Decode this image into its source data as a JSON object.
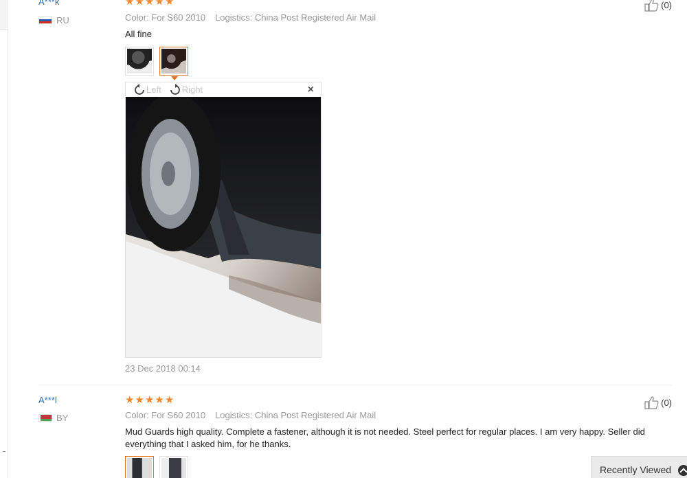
{
  "reviews": [
    {
      "user": "A***k",
      "country": "RU",
      "stars": 5,
      "color_label": "Color: For S60 2010",
      "logistics_label": "Logistics: China Post Registered Air Mail",
      "feedback": "All fine",
      "date": "23 Dec 2018 00:14",
      "helpful_count": "(0)",
      "viewer": {
        "rotate_left": "Left",
        "rotate_right": "Right",
        "close": "×"
      }
    },
    {
      "user": "A***l",
      "country": "BY",
      "stars": 5,
      "color_label": "Color: For S60 2010",
      "logistics_label": "Logistics: China Post Registered Air Mail",
      "feedback": "Mud Guards high quality. Complete a fastener, although it is not needed. Steel perfect for regular places. I am very happy. Seller did everything that I asked him, for he thanks.",
      "helpful_count": "(0)"
    }
  ],
  "recently_viewed": "Recently Viewed",
  "colors": {
    "star": "#f8872c",
    "link": "#2f6fb5",
    "active_thumb": "#e6731f"
  }
}
